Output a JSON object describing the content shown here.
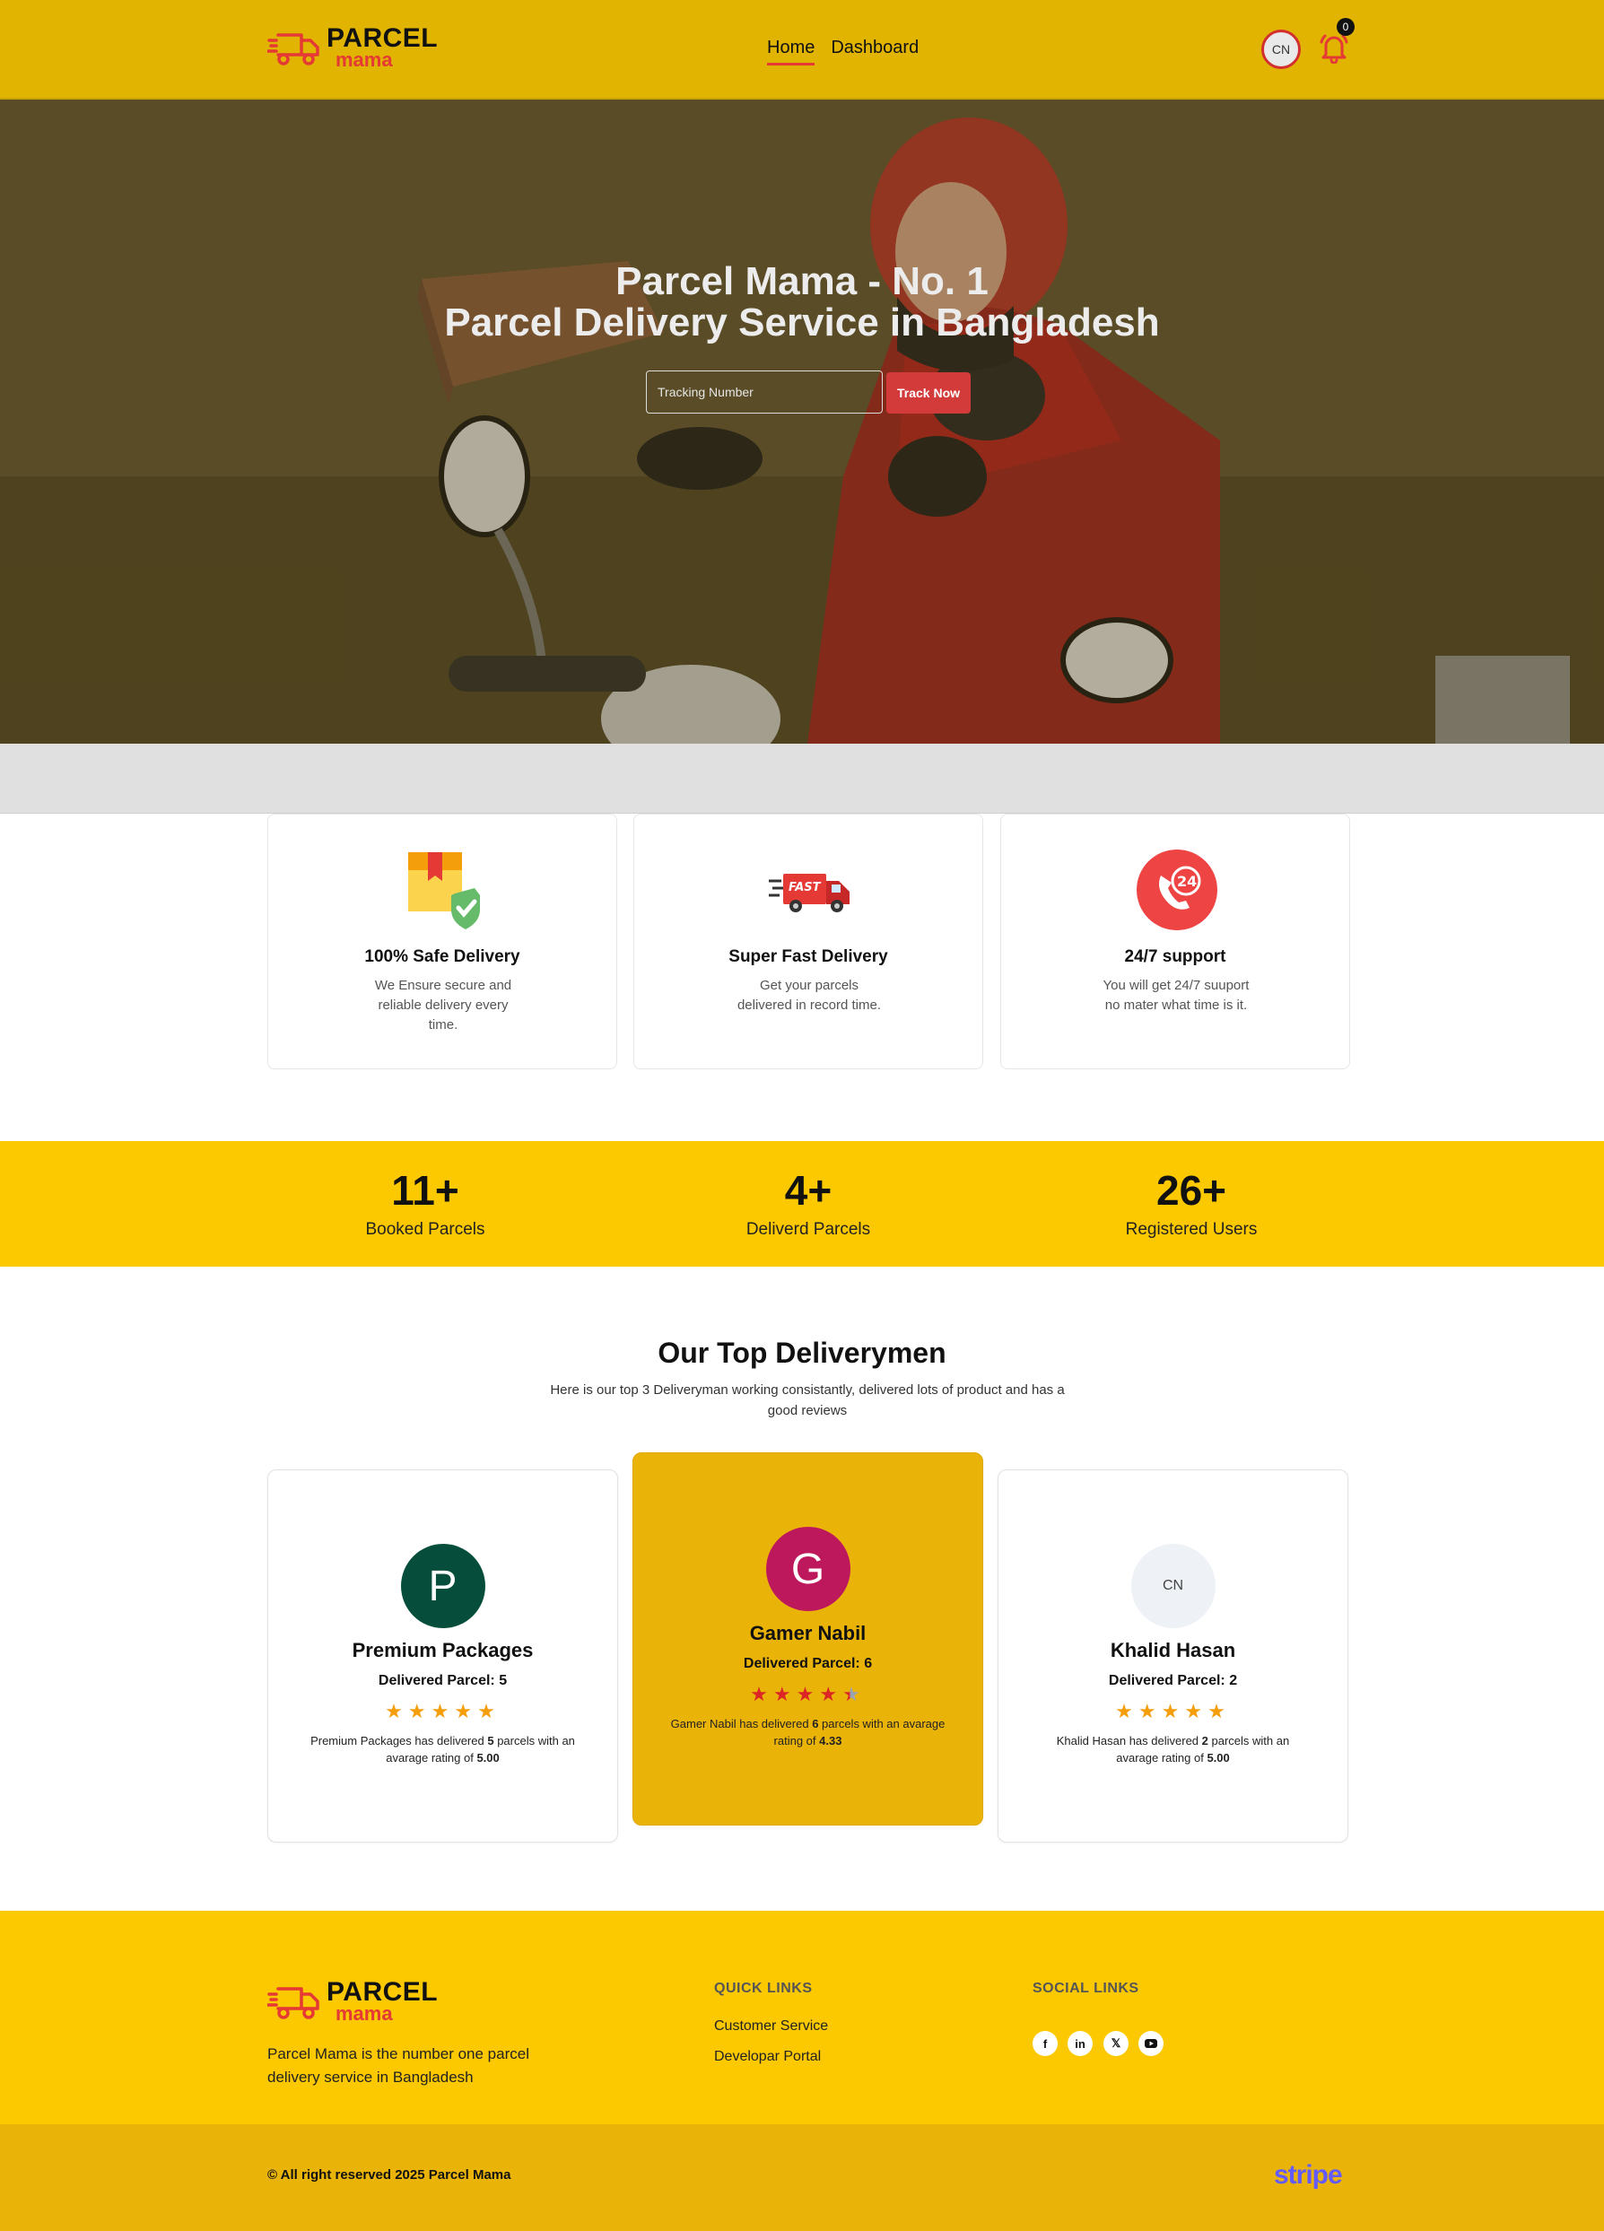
{
  "brand": {
    "word1": "PARCEL",
    "word2": "mama"
  },
  "nav": {
    "home": "Home",
    "dashboard": "Dashboard",
    "avatar_initials": "CN",
    "notification_count": "0"
  },
  "hero": {
    "title_line1": "Parcel Mama - No. 1",
    "title_line2": "Parcel Delivery Service in Bangladesh",
    "tracking_placeholder": "Tracking Number",
    "track_button": "Track Now"
  },
  "features": [
    {
      "icon": "safe-box-icon",
      "title": "100% Safe Delivery",
      "desc": "We Ensure secure and reliable delivery every time."
    },
    {
      "icon": "fast-truck-icon",
      "title": "Super Fast Delivery",
      "desc": "Get your parcels delivered in record time."
    },
    {
      "icon": "support-24-icon",
      "title": "24/7 support",
      "desc": "You will get 24/7 suuport no mater what time is it."
    }
  ],
  "stats": [
    {
      "value": "11+",
      "label": "Booked Parcels"
    },
    {
      "value": "4+",
      "label": "Deliverd Parcels"
    },
    {
      "value": "26+",
      "label": "Registered Users"
    }
  ],
  "top_deliverymen": {
    "title": "Our Top Deliverymen",
    "subtitle": "Here is our top 3 Deliveryman working consistantly, delivered lots of product and has a good reviews",
    "cards": [
      {
        "initial": "P",
        "avatar_color": "#064e3b",
        "name": "Premium Packages",
        "delivered_label": "Delivered Parcel: 5",
        "rating": 5.0,
        "desc_pre": "Premium Packages has delivered ",
        "count": "5",
        "desc_mid": " parcels with an avarage rating of ",
        "rating_text": "5.00",
        "star_color": "#f59e0b"
      },
      {
        "initial": "G",
        "avatar_color": "#be185d",
        "name": "Gamer Nabil",
        "delivered_label": "Delivered Parcel: 6",
        "rating": 4.33,
        "desc_pre": "Gamer Nabil has delivered ",
        "count": "6",
        "desc_mid": " parcels with an avarage rating of ",
        "rating_text": "4.33",
        "star_color": "#dc2626"
      },
      {
        "initial": "CN",
        "avatar_color": "#eef1f5",
        "name": "Khalid Hasan",
        "delivered_label": "Delivered Parcel: 2",
        "rating": 5.0,
        "desc_pre": "Khalid Hasan has delivered ",
        "count": "2",
        "desc_mid": " parcels with an avarage rating of ",
        "rating_text": "5.00",
        "star_color": "#f59e0b"
      }
    ]
  },
  "footer": {
    "about": "Parcel Mama is the number one parcel delivery service in Bangladesh",
    "quick_links_title": "QUICK LINKS",
    "quick_links": [
      "Customer Service",
      "Developar Portal"
    ],
    "social_title": "SOCIAL LINKS",
    "social": [
      "facebook-icon",
      "linkedin-icon",
      "x-icon",
      "youtube-icon"
    ],
    "copyright": "© All right reserved 2025 Parcel Mama",
    "payment_brand": "stripe"
  },
  "colors": {
    "primary_yellow": "#fcc800",
    "nav_yellow": "#e0b400",
    "accent_red": "#e53935"
  }
}
